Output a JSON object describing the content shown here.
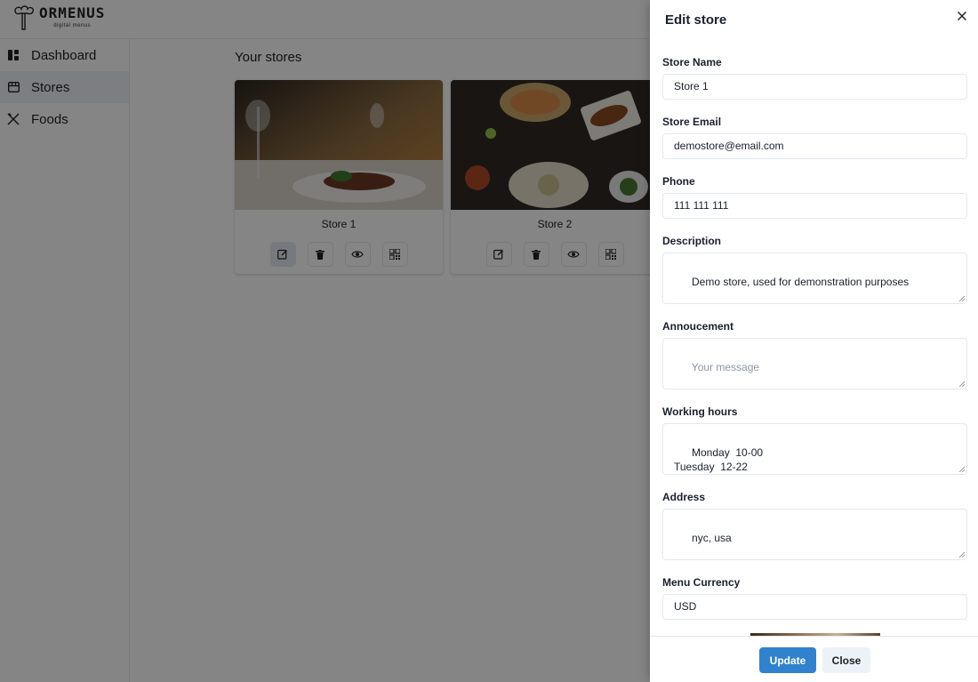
{
  "brand": {
    "name": "ORMENUS",
    "tagline": "digital menus"
  },
  "sidebar": {
    "items": [
      {
        "label": "Dashboard",
        "icon": "dashboard-icon"
      },
      {
        "label": "Stores",
        "icon": "store-icon",
        "active": true
      },
      {
        "label": "Foods",
        "icon": "utensils-icon"
      }
    ]
  },
  "main": {
    "title": "Your stores",
    "stores": [
      {
        "name": "Store 1",
        "image": "plated-dish-photo"
      },
      {
        "name": "Store 2",
        "image": "food-table-photo"
      }
    ],
    "card_actions": [
      "edit-icon",
      "trash-icon",
      "eye-icon",
      "qr-code-icon"
    ]
  },
  "drawer": {
    "title": "Edit store",
    "fields": {
      "store_name": {
        "label": "Store Name",
        "value": "Store 1"
      },
      "store_email": {
        "label": "Store Email",
        "value": "demostore@email.com"
      },
      "phone": {
        "label": "Phone",
        "value": "111 111 111"
      },
      "description": {
        "label": "Description",
        "value": "Demo store, used for demonstration purposes"
      },
      "announcement": {
        "label": "Annoucement",
        "placeholder": "Your message"
      },
      "working_hours": {
        "label": "Working hours",
        "value": "Monday  10-00\nTuesday  12-22"
      },
      "address": {
        "label": "Address",
        "value": "nyc, usa"
      },
      "currency": {
        "label": "Menu Currency",
        "value": "USD"
      }
    },
    "update_label": "Update",
    "close_label": "Close"
  },
  "colors": {
    "accent": "#3182ce",
    "overlay": "rgba(0,0,0,0.48)",
    "active_nav": "#edf2f7"
  }
}
